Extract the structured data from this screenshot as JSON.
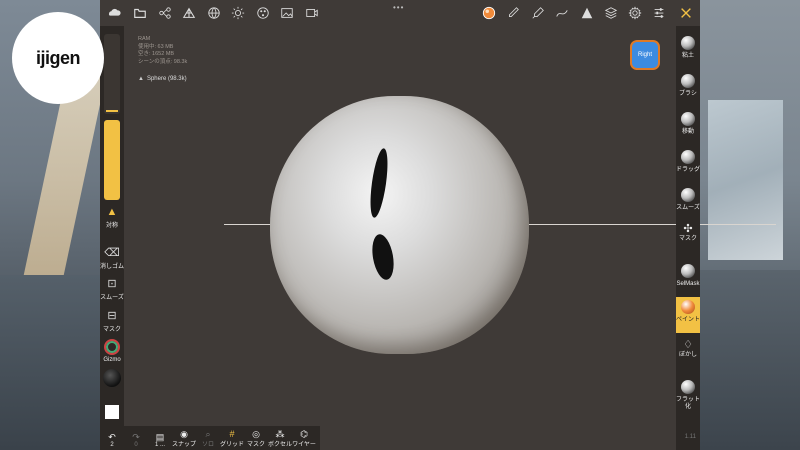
{
  "logo": {
    "text": "ijigen"
  },
  "topbar": {
    "dots": "•••"
  },
  "stats": {
    "ram": "RAM",
    "used": "使用中: 63 MB",
    "free": "空き: 1652 MB",
    "vertices": "シーンの頂点: 98.3k"
  },
  "object": {
    "label": "Sphere (98.3k)"
  },
  "viewcube": {
    "label": "Right"
  },
  "left_sidebar": {
    "symmetry": "対称",
    "eraser": "消しゴム",
    "smooth": "スムーズ",
    "mask": "マスク",
    "gizmo": "Gizmo"
  },
  "right_sidebar": [
    {
      "label": "粘土"
    },
    {
      "label": "ブラシ"
    },
    {
      "label": "移動"
    },
    {
      "label": "ドラッグ"
    },
    {
      "label": "スムーズ"
    },
    {
      "label": "マスク"
    },
    {
      "label": "SelMask"
    },
    {
      "label": "ペイント"
    },
    {
      "label": "ぼかし"
    },
    {
      "label": "フラット化"
    }
  ],
  "bottom_bar": {
    "undo_count": "2",
    "redo_count": "0",
    "item3_label": "1 ...",
    "snap": "スナップ",
    "ortho": "ソロ",
    "grid": "グリッド",
    "mask": "マスク",
    "voxel": "ボクセル",
    "wire": "ワイヤー"
  },
  "corner_value": "1.11",
  "colors": {
    "accent": "#f2c144",
    "viewcube": "#3d8be0"
  }
}
